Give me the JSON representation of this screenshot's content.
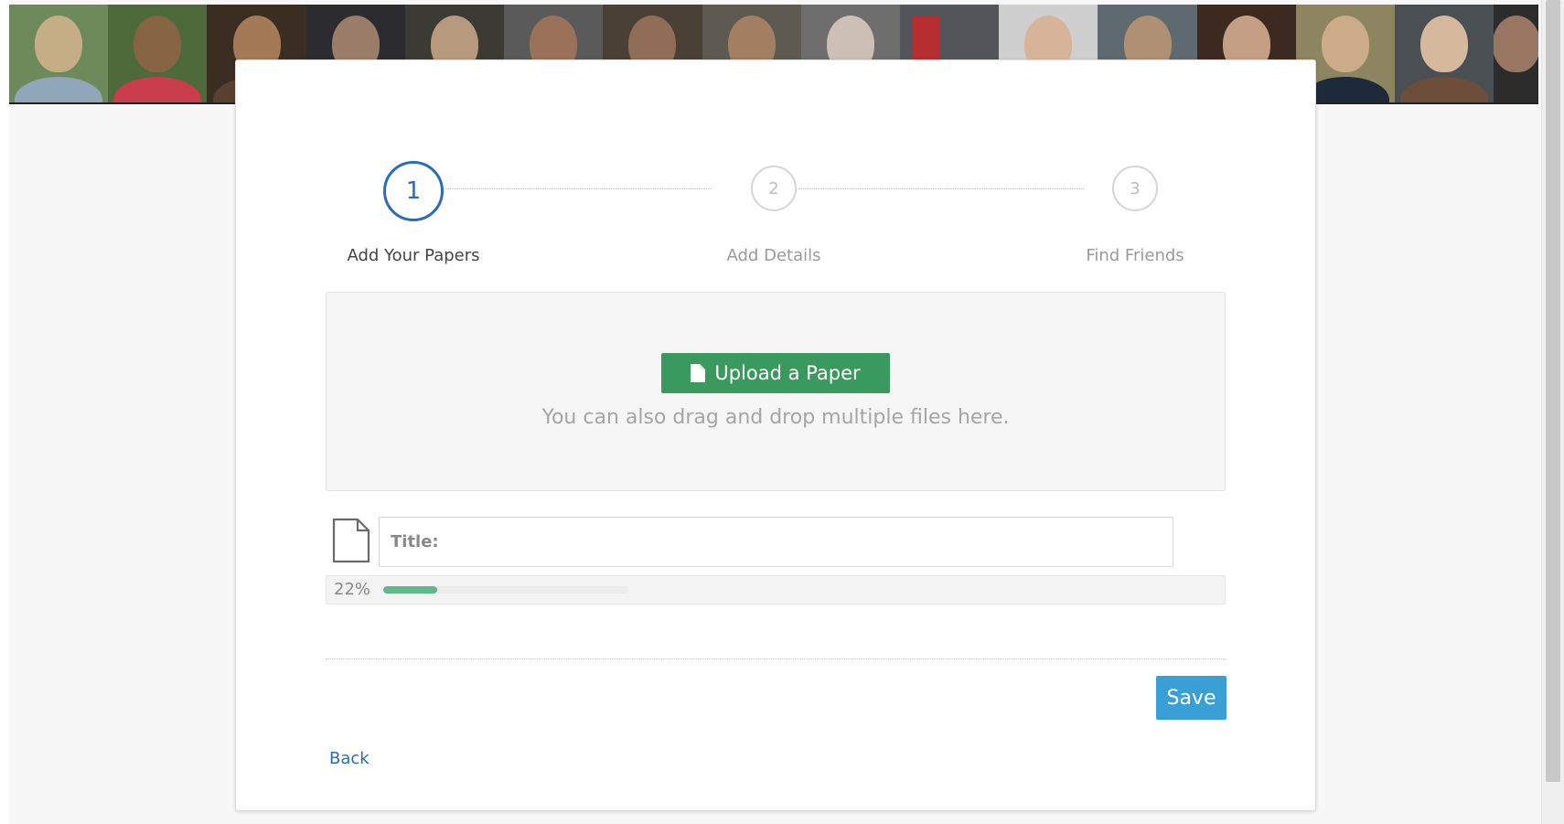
{
  "stepper": {
    "steps": [
      {
        "number": "1",
        "label": "Add Your Papers",
        "state": "active"
      },
      {
        "number": "2",
        "label": "Add Details",
        "state": "inactive"
      },
      {
        "number": "3",
        "label": "Find Friends",
        "state": "inactive"
      }
    ]
  },
  "upload": {
    "button_label": "Upload a Paper",
    "icon": "file-icon",
    "hint": "You can also drag and drop multiple files here."
  },
  "file_row": {
    "icon": "document-icon",
    "title_label": "Title:",
    "title_value": "",
    "progress_text": "22%",
    "progress_percent": 22
  },
  "actions": {
    "save_label": "Save",
    "back_label": "Back"
  },
  "colors": {
    "active_step": "#2a6db6",
    "upload_button": "#3a9a5e",
    "save_button": "#3a9fd5",
    "progress_fill": "#5fb88a",
    "link": "#2a6db6"
  }
}
